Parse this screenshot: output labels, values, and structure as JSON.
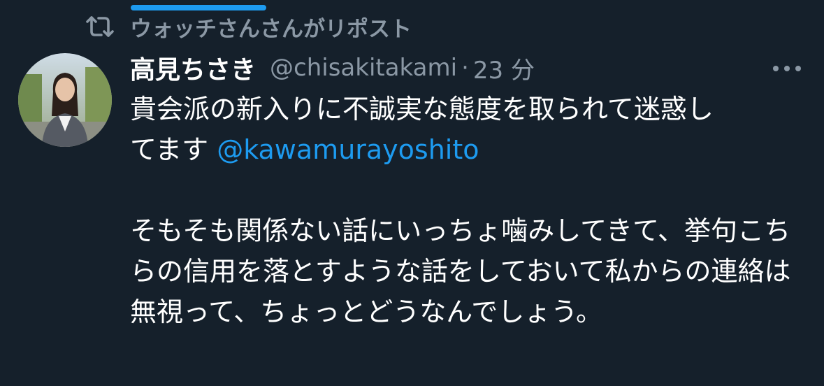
{
  "colors": {
    "background": "#15202b",
    "text_primary": "#ffffff",
    "text_secondary": "#8b98a5",
    "accent": "#1d9bf0"
  },
  "retweet": {
    "icon": "retweet-icon",
    "label": "ウォッチさんさんがリポスト"
  },
  "tweet": {
    "author_name": "高見ちさき",
    "handle": "@chisakitakami",
    "separator": "·",
    "time": "23 分",
    "more_icon": "more-horizontal-icon",
    "paragraph1_line1": "貴会派の新入りに不誠実な態度を取られて迷惑し",
    "paragraph1_line2_prefix": "てます ",
    "mention": "@kawamurayoshito",
    "paragraph2": "そもそも関係ない話にいっちょ噛みしてきて、挙句こちらの信用を落とすような話をしておいて私からの連絡は無視って、ちょっとどうなんでしょう。"
  }
}
